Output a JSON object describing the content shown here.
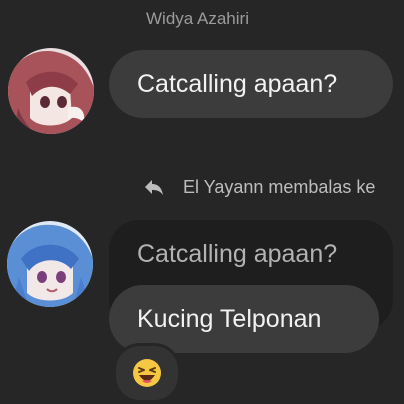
{
  "thread": {
    "sender_name": "Widya Azahiri",
    "reply_banner": "El Yayann membalas ke",
    "messages": [
      {
        "text": "Catcalling apaan?"
      },
      {
        "quoted_text": "Catcalling apaan?",
        "text": "Kucing Telponan",
        "reaction": "laughing-emoji-icon"
      }
    ]
  },
  "colors": {
    "background": "#262626",
    "bubble": "#3c3c3c",
    "quoted_bubble": "#1e1e1e",
    "secondary_text": "#9b9b9b"
  }
}
